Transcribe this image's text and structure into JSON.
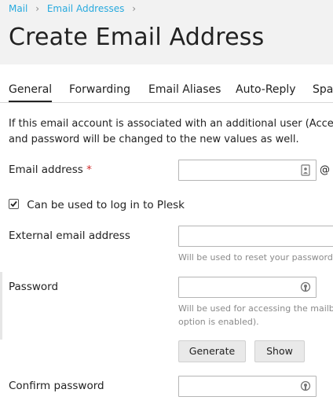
{
  "breadcrumb": {
    "items": [
      "Mail",
      "Email Addresses"
    ],
    "separator": "›"
  },
  "page": {
    "title": "Create Email Address"
  },
  "tabs": [
    {
      "label": "General",
      "active": true
    },
    {
      "label": "Forwarding",
      "active": false
    },
    {
      "label": "Email Aliases",
      "active": false
    },
    {
      "label": "Auto-Reply",
      "active": false
    },
    {
      "label": "Spa",
      "active": false
    }
  ],
  "info": {
    "line1": "If this email account is associated with an additional user (Acces",
    "line2": "and password will be changed to the new values as well."
  },
  "form": {
    "email": {
      "label": "Email address",
      "required_mark": "*",
      "value": "",
      "at": "@"
    },
    "login_checkbox": {
      "label": "Can be used to log in to Plesk",
      "checked": true
    },
    "external_email": {
      "label": "External email address",
      "value": "",
      "hint": "Will be used to reset your password"
    },
    "password": {
      "label": "Password",
      "value": "",
      "hint_line1": "Will be used for accessing the mailb",
      "hint_line2": "option is enabled).",
      "generate_label": "Generate",
      "show_label": "Show"
    },
    "confirm_password": {
      "label": "Confirm password",
      "value": ""
    }
  },
  "colors": {
    "link": "#28aade",
    "header_bg": "#f2f2f2",
    "required": "#d02b2b"
  }
}
